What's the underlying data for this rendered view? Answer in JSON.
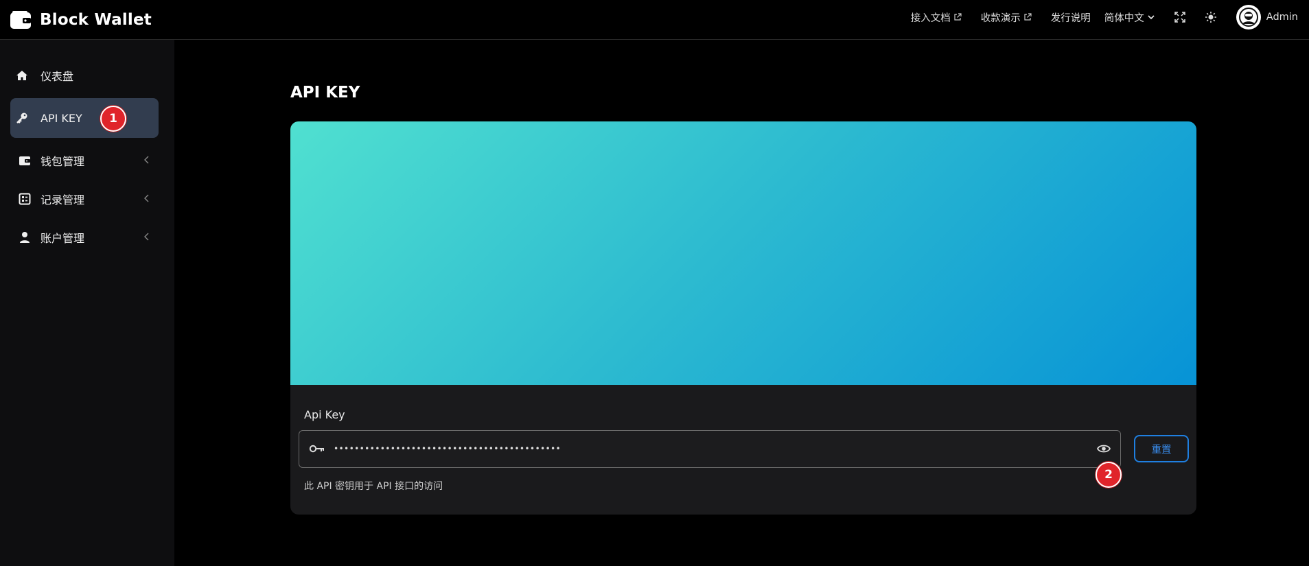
{
  "header": {
    "brand_title": "Block Wallet",
    "nav": {
      "docs": "接入文档",
      "demo": "收款演示",
      "release": "发行说明",
      "language": "简体中文"
    },
    "user_name": "Admin"
  },
  "sidebar": {
    "items": [
      {
        "label": "仪表盘",
        "icon": "home-icon"
      },
      {
        "label": "API KEY",
        "icon": "key-icon"
      },
      {
        "label": "钱包管理",
        "icon": "wallet-icon"
      },
      {
        "label": "记录管理",
        "icon": "records-icon"
      },
      {
        "label": "账户管理",
        "icon": "user-icon"
      }
    ],
    "badge": "1"
  },
  "main": {
    "page_title": "API KEY",
    "field_label": "Api Key",
    "api_key_value": "••••••••••••••••••••••••••••••••••••••••••••",
    "reset_label": "重置",
    "hint": "此 API 密钥用于 API 接口的访问",
    "badge": "2"
  },
  "colors": {
    "active_bg": "#323d4f",
    "accent": "#1f7fe0",
    "badge": "#e0242a",
    "gradient_start": "#50e0d0",
    "gradient_end": "#0793d6"
  }
}
